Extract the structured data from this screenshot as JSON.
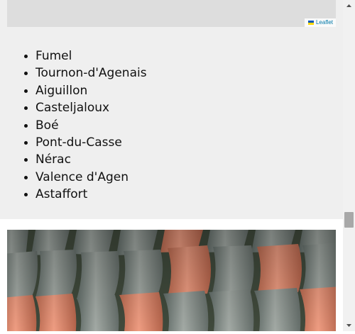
{
  "map": {
    "attribution_label": "Leaflet",
    "flag_colors": [
      "#0057b7",
      "#ffd700"
    ]
  },
  "towns": [
    "Fumel",
    "Tournon-d'Agenais",
    "Aiguillon",
    "Casteljaloux",
    "Boé",
    "Pont-du-Casse",
    "Nérac",
    "Valence d'Agen",
    "Astaffort"
  ],
  "photo": {
    "subject": "roof-tiles-photo"
  },
  "colors": {
    "section_background": "#efefef",
    "map_background": "#dddddd",
    "link": "#0078a8"
  }
}
